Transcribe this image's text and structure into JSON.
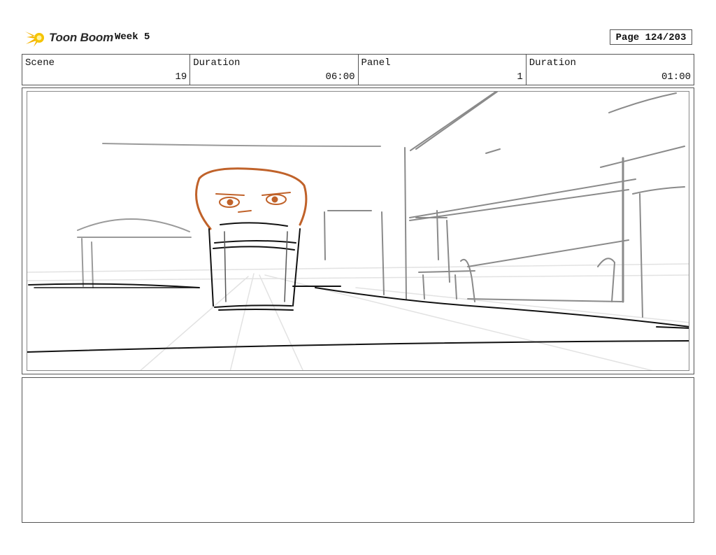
{
  "header": {
    "logo_text": "Toon Boom",
    "title": "Week 5",
    "page_label": "Page 124/203"
  },
  "info": {
    "scene_label": "Scene",
    "scene_value": "19",
    "scene_duration_label": "Duration",
    "scene_duration_value": "06:00",
    "panel_label": "Panel",
    "panel_value": "1",
    "panel_duration_label": "Duration",
    "panel_duration_value": "01:00"
  },
  "colors": {
    "sketch_dark": "#111111",
    "sketch_grey": "#8a8a8a",
    "sketch_light": "#d8d8d8",
    "character": "#c0622a",
    "logo_accent": "#f5b400"
  },
  "notes": {
    "text": ""
  }
}
